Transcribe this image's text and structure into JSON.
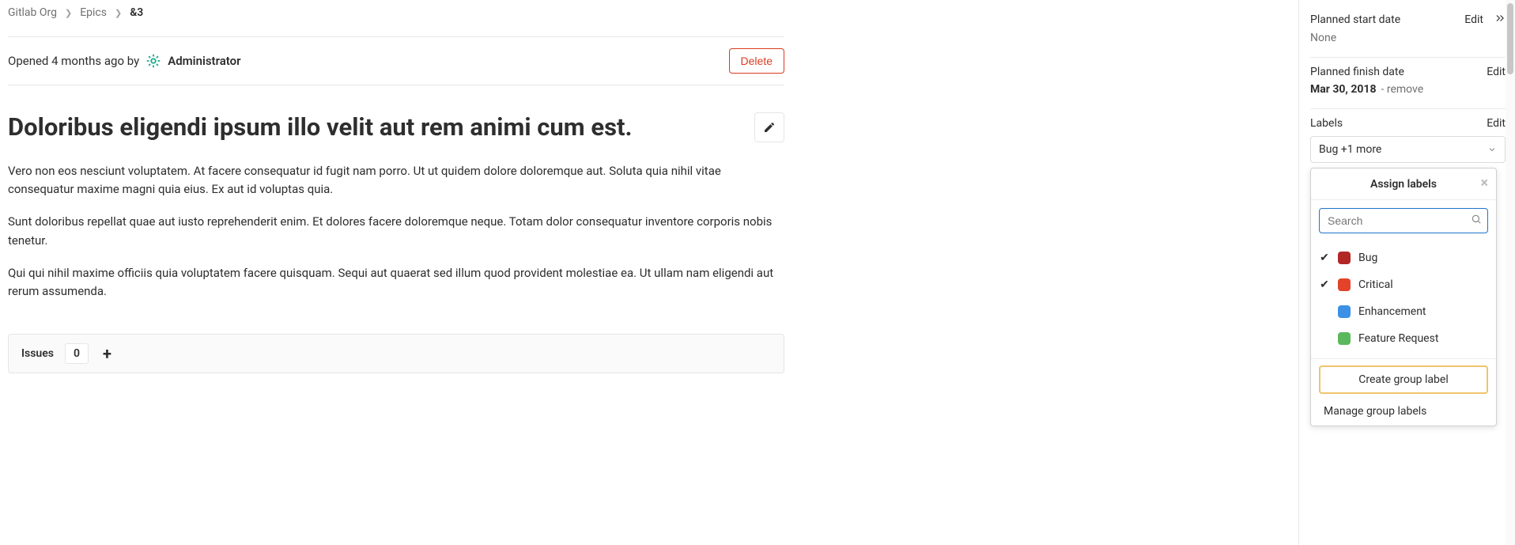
{
  "breadcrumbs": {
    "root": "Gitlab Org",
    "section": "Epics",
    "current": "&3"
  },
  "header": {
    "opened_text": "Opened 4 months ago by",
    "author": "Administrator",
    "delete_label": "Delete"
  },
  "epic": {
    "title": "Doloribus eligendi ipsum illo velit aut rem animi cum est.",
    "para1": "Vero non eos nesciunt voluptatem. At facere consequatur id fugit nam porro. Ut ut quidem dolore doloremque aut. Soluta quia nihil vitae consequatur maxime magni quia eius. Ex aut id voluptas quia.",
    "para2": "Sunt doloribus repellat quae aut iusto reprehenderit enim. Et dolores facere doloremque neque. Totam dolor consequatur inventore corporis nobis tenetur.",
    "para3": "Qui qui nihil maxime officiis quia voluptatem facere quisquam. Sequi aut quaerat sed illum quod provident molestiae ea. Ut ullam nam eligendi aut rerum assumenda."
  },
  "issues": {
    "label": "Issues",
    "count": "0"
  },
  "sidebar": {
    "start": {
      "title": "Planned start date",
      "action": "Edit",
      "value": "None"
    },
    "finish": {
      "title": "Planned finish date",
      "action": "Edit",
      "value": "Mar 30, 2018",
      "remove": "- remove"
    },
    "labels": {
      "title": "Labels",
      "action": "Edit",
      "selected_summary": "Bug +1 more"
    }
  },
  "dropdown": {
    "title": "Assign labels",
    "search_placeholder": "Search",
    "items": [
      {
        "label": "Bug",
        "color": "#b22626",
        "checked": true
      },
      {
        "label": "Critical",
        "color": "#e24329",
        "checked": true
      },
      {
        "label": "Enhancement",
        "color": "#3c91e6",
        "checked": false
      },
      {
        "label": "Feature Request",
        "color": "#5cb85c",
        "checked": false
      }
    ],
    "create_label": "Create group label",
    "manage_label": "Manage group labels"
  }
}
